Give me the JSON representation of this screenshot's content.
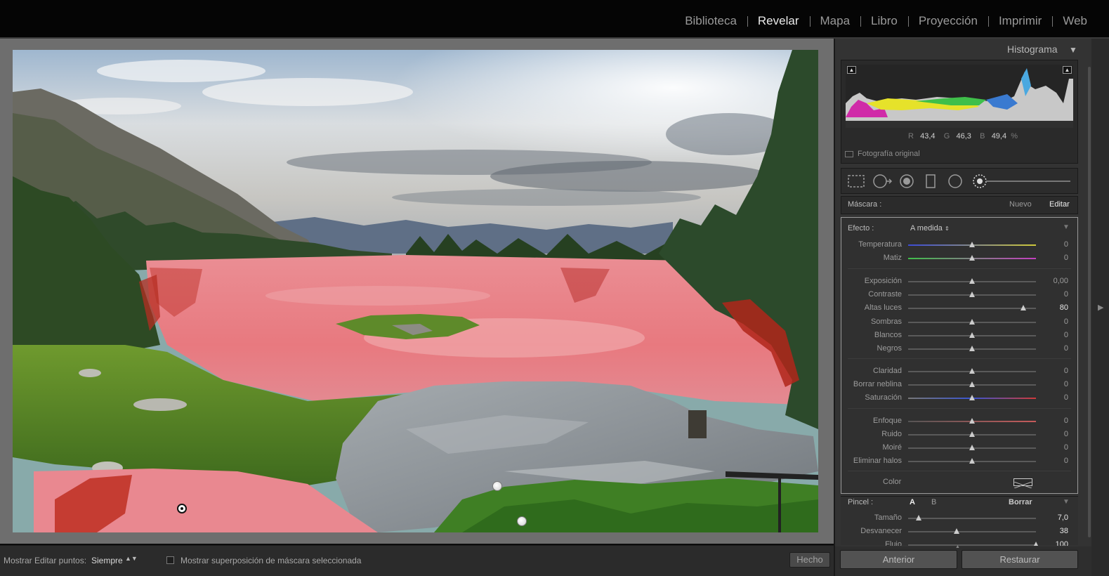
{
  "nav": {
    "modules": [
      {
        "label": "Biblioteca",
        "active": false
      },
      {
        "label": "Revelar",
        "active": true
      },
      {
        "label": "Mapa",
        "active": false
      },
      {
        "label": "Libro",
        "active": false
      },
      {
        "label": "Proyección",
        "active": false
      },
      {
        "label": "Imprimir",
        "active": false
      },
      {
        "label": "Web",
        "active": false
      }
    ]
  },
  "toolbar": {
    "show_points_label": "Mostrar Editar puntos:",
    "show_points_value": "Siempre",
    "overlay_label": "Mostrar superposición de máscara seleccionada",
    "done_label": "Hecho"
  },
  "histogram": {
    "title": "Histograma",
    "r_label": "R",
    "r_value": "43,4",
    "g_label": "G",
    "g_value": "46,3",
    "b_label": "B",
    "b_value": "49,4",
    "percent": "%",
    "original_photo_label": "Fotografía original"
  },
  "mask": {
    "label": "Máscara :",
    "new_label": "Nuevo",
    "edit_label": "Editar"
  },
  "effect": {
    "label": "Efecto :",
    "value": "A medida",
    "color_label": "Color"
  },
  "sliders": [
    {
      "label": "Temperatura",
      "value": "0",
      "pos": 0.5,
      "track": "temp"
    },
    {
      "label": "Matiz",
      "value": "0",
      "pos": 0.5,
      "track": "tint"
    },
    {
      "label": "Exposición",
      "value": "0,00",
      "pos": 0.5,
      "track": "plain"
    },
    {
      "label": "Contraste",
      "value": "0",
      "pos": 0.5,
      "track": "plain"
    },
    {
      "label": "Altas luces",
      "value": "80",
      "pos": 0.9,
      "track": "plain",
      "highlight": true
    },
    {
      "label": "Sombras",
      "value": "0",
      "pos": 0.5,
      "track": "plain"
    },
    {
      "label": "Blancos",
      "value": "0",
      "pos": 0.5,
      "track": "plain"
    },
    {
      "label": "Negros",
      "value": "0",
      "pos": 0.5,
      "track": "plain"
    },
    {
      "label": "Claridad",
      "value": "0",
      "pos": 0.5,
      "track": "plain"
    },
    {
      "label": "Borrar neblina",
      "value": "0",
      "pos": 0.5,
      "track": "plain"
    },
    {
      "label": "Saturación",
      "value": "0",
      "pos": 0.5,
      "track": "sat"
    },
    {
      "label": "Enfoque",
      "value": "0",
      "pos": 0.5,
      "track": "sharp"
    },
    {
      "label": "Ruido",
      "value": "0",
      "pos": 0.5,
      "track": "plain"
    },
    {
      "label": "Moiré",
      "value": "0",
      "pos": 0.5,
      "track": "plain"
    },
    {
      "label": "Eliminar halos",
      "value": "0",
      "pos": 0.5,
      "track": "plain"
    }
  ],
  "brush": {
    "label": "Pincel :",
    "a_label": "A",
    "b_label": "B",
    "erase_label": "Borrar",
    "sliders": [
      {
        "label": "Tamaño",
        "value": "7,0",
        "pos": 0.08
      },
      {
        "label": "Desvanecer",
        "value": "38",
        "pos": 0.38
      },
      {
        "label": "Flujo",
        "value": "100",
        "pos": 1.0
      }
    ]
  },
  "buttons": {
    "previous_label": "Anterior",
    "reset_label": "Restaurar"
  },
  "colors": {
    "mask_overlay": "#e87c84",
    "panel_bg": "#333333",
    "canvas_bg": "#6e6e6e"
  }
}
